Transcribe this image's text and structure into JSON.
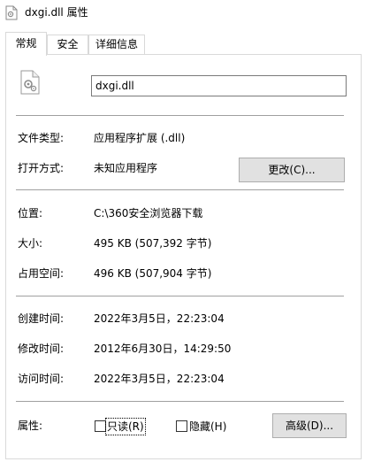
{
  "window": {
    "title": "dxgi.dll 属性"
  },
  "tabs": [
    {
      "label": "常规"
    },
    {
      "label": "安全"
    },
    {
      "label": "详细信息"
    }
  ],
  "general": {
    "file_name": "dxgi.dll",
    "type_label": "文件类型:",
    "type_value": "应用程序扩展 (.dll)",
    "opens_label": "打开方式:",
    "opens_value": "未知应用程序",
    "change_button": "更改(C)...",
    "location_label": "位置:",
    "location_value": "C:\\360安全浏览器下载",
    "size_label": "大小:",
    "size_value": "495 KB (507,392 字节)",
    "size_on_disk_label": "占用空间:",
    "size_on_disk_value": "496 KB (507,904 字节)",
    "created_label": "创建时间:",
    "created_value": "2022年3月5日，22:23:04",
    "modified_label": "修改时间:",
    "modified_value": "2012年6月30日，14:29:50",
    "accessed_label": "访问时间:",
    "accessed_value": "2022年3月5日，22:23:04",
    "attributes_label": "属性:",
    "readonly_label": "只读(R)",
    "readonly_checked": false,
    "hidden_label": "隐藏(H)",
    "hidden_checked": false,
    "advanced_button": "高级(D)..."
  },
  "icons": {
    "title_icon": "file-gear-icon",
    "file_icon": "dll-file-icon"
  }
}
